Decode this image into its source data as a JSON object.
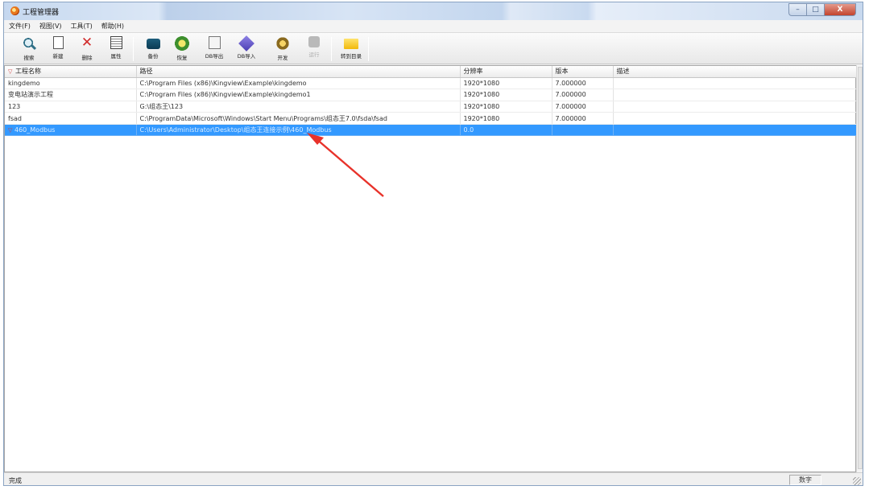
{
  "window": {
    "title": "工程管理器"
  },
  "window_buttons": {
    "minimize": "–",
    "restore": "□",
    "close": "X"
  },
  "menu": [
    "文件(F)",
    "视图(V)",
    "工具(T)",
    "帮助(H)"
  ],
  "toolbar": [
    {
      "label": "搜索",
      "icon": "search-icon",
      "enabled": true
    },
    {
      "label": "新建",
      "icon": "new-file-icon",
      "enabled": true
    },
    {
      "label": "删除",
      "icon": "delete-icon",
      "enabled": true
    },
    {
      "label": "属性",
      "icon": "properties-icon",
      "enabled": true
    },
    {
      "label": "备份",
      "icon": "backup-icon",
      "enabled": true
    },
    {
      "label": "恢复",
      "icon": "restore-icon",
      "enabled": true
    },
    {
      "label": "DB导出",
      "icon": "db-export-icon",
      "enabled": true
    },
    {
      "label": "DB导入",
      "icon": "db-import-icon",
      "enabled": true
    },
    {
      "label": "开发",
      "icon": "develop-icon",
      "enabled": true
    },
    {
      "label": "运行",
      "icon": "run-icon",
      "enabled": false
    },
    {
      "label": "转到目录",
      "icon": "folder-icon",
      "enabled": true
    }
  ],
  "table": {
    "columns": [
      "工程名称",
      "路径",
      "分辨率",
      "版本",
      "描述"
    ],
    "rows": [
      {
        "name": "kingdemo",
        "path": "C:\\Program Files (x86)\\Kingview\\Example\\kingdemo",
        "resolution": "1920*1080",
        "version": "7.000000",
        "desc": "",
        "selected": false
      },
      {
        "name": "变电站演示工程",
        "path": "C:\\Program Files (x86)\\Kingview\\Example\\kingdemo1",
        "resolution": "1920*1080",
        "version": "7.000000",
        "desc": "",
        "selected": false
      },
      {
        "name": "123",
        "path": "G:\\组态王\\123",
        "resolution": "1920*1080",
        "version": "7.000000",
        "desc": "",
        "selected": false
      },
      {
        "name": "fsad",
        "path": "C:\\ProgramData\\Microsoft\\Windows\\Start Menu\\Programs\\组态王7.0\\fsda\\fsad",
        "resolution": "1920*1080",
        "version": "7.000000",
        "desc": "",
        "selected": false
      },
      {
        "name": "460_Modbus",
        "path": "C:\\Users\\Administrator\\Desktop\\组态王连接示例\\460_Modbus",
        "resolution": "0.0",
        "version": "",
        "desc": "",
        "selected": true
      }
    ]
  },
  "status": {
    "text": "完成",
    "panel": "数字"
  },
  "colors": {
    "selection": "#3399ff",
    "arrow": "#e8322a"
  }
}
